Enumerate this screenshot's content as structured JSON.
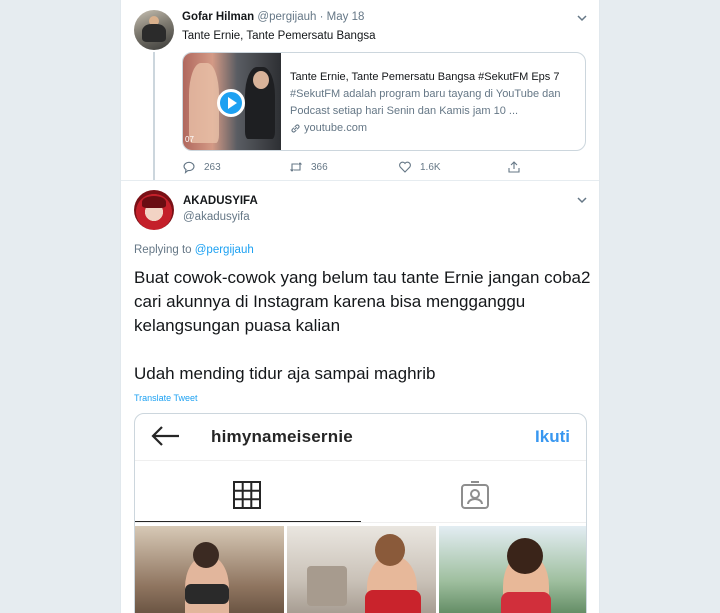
{
  "parent_tweet": {
    "name": "Gofar Hilman",
    "handle": "@pergijauh",
    "separator": "·",
    "date": "May 18",
    "text": "Tante Ernie, Tante Pemersatu Bangsa",
    "card": {
      "title": "Tante Ernie, Tante Pemersatu Bangsa #SekutFM Eps 7",
      "description": "#SekutFM adalah program baru tayang di YouTube dan Podcast setiap hari Senin dan Kamis jam 10 ...",
      "domain": "youtube.com",
      "thumb_tag": "07"
    },
    "actions": {
      "replies": "263",
      "retweets": "366",
      "likes": "1.6K"
    }
  },
  "tweet": {
    "name": "AKADUSYIFA",
    "handle": "@akadusyifa",
    "replying_label": "Replying to",
    "replying_to": "@pergijauh",
    "paragraph1": "Buat cowok-cowok yang belum tau tante Ernie jangan coba2 cari akunnya di Instagram karena bisa mengganggu kelangsungan puasa kalian",
    "paragraph2": "Udah mending tidur aja sampai maghrib",
    "translate_label": "Translate Tweet",
    "media": {
      "username": "himynameisernie",
      "follow_label": "Ikuti"
    }
  },
  "icons": [
    "chevron-down-icon",
    "play-icon",
    "link-icon",
    "reply-icon",
    "retweet-icon",
    "like-icon",
    "share-icon",
    "back-arrow-icon",
    "grid-icon",
    "tagged-icon"
  ],
  "colors": {
    "accent": "#1da1f2",
    "text": "#14171a",
    "muted": "#657786",
    "ig_blue": "#3897f0"
  }
}
